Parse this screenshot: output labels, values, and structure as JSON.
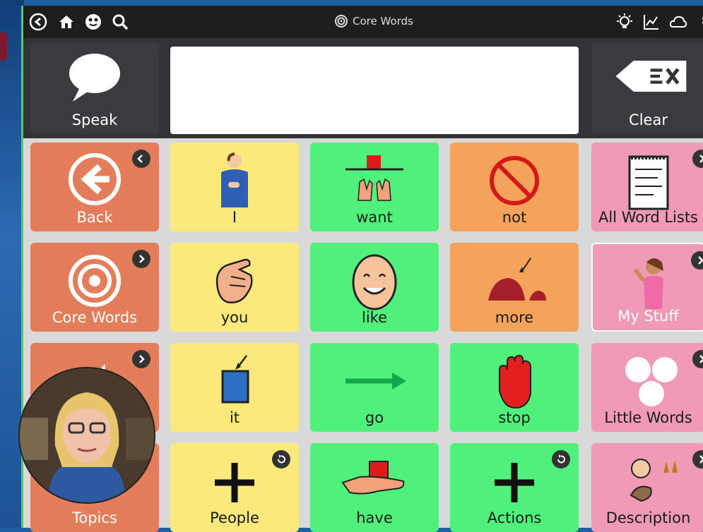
{
  "toolbar": {
    "title": "Core Words"
  },
  "top_row": {
    "speak": "Speak",
    "clear": "Clear"
  },
  "cells": [
    {
      "label": "Back"
    },
    {
      "label": "I"
    },
    {
      "label": "want"
    },
    {
      "label": "not"
    },
    {
      "label": "All Word Lists"
    },
    {
      "label": "Core Words"
    },
    {
      "label": "you"
    },
    {
      "label": "like"
    },
    {
      "label": "more"
    },
    {
      "label": "My Stuff"
    },
    {
      "label": ""
    },
    {
      "label": "it"
    },
    {
      "label": "go"
    },
    {
      "label": "stop"
    },
    {
      "label": "Little Words"
    },
    {
      "label": "Topics"
    },
    {
      "label": "People"
    },
    {
      "label": "have"
    },
    {
      "label": "Actions"
    },
    {
      "label": "Description"
    }
  ],
  "colors": {
    "pronoun": "#fbe97c",
    "verb": "#4ff17a",
    "modifier": "#f5a35b",
    "category": "#f09ab8",
    "navigation": "#e47d5a"
  }
}
